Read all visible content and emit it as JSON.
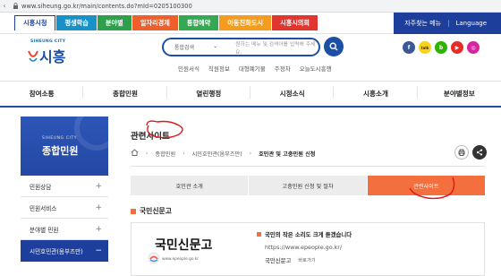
{
  "browser": {
    "url": "www.siheung.go.kr/main/contents.do?mId=0205100300"
  },
  "top_tabs": [
    {
      "label": "시흥시청",
      "color": "#1d3f9b",
      "active": true
    },
    {
      "label": "평생학습",
      "color": "#1891c9",
      "active": false
    },
    {
      "label": "분야별",
      "color": "#2ea04d",
      "active": false
    },
    {
      "label": "일자리경제",
      "color": "#ee5f2b",
      "active": false
    },
    {
      "label": "통합예약",
      "color": "#34a853",
      "active": false
    },
    {
      "label": "아동친화도시",
      "color": "#f39c1d",
      "active": false
    },
    {
      "label": "시흥시의회",
      "color": "#e0362f",
      "active": false
    }
  ],
  "top_links": {
    "freq_menu": "자주찾는 메뉴",
    "language": "Language"
  },
  "header": {
    "logo_small": "SIHEUNG CITY",
    "logo_main": "시흥",
    "search_select": "통합검색",
    "search_placeholder": "원하는 메뉴 및 검색어를 입력해 주세요.",
    "quick_links": [
      "민원서식",
      "직원정보",
      "대형폐기물",
      "주정차",
      "오늘도시흥행"
    ],
    "social": [
      {
        "name": "facebook-icon",
        "color": "#3b5998",
        "glyph": "f"
      },
      {
        "name": "kakao-icon",
        "color": "#f7d417",
        "glyph": "talk"
      },
      {
        "name": "blog-icon",
        "color": "#2db400",
        "glyph": "b"
      },
      {
        "name": "youtube-icon",
        "color": "#e52d27",
        "glyph": "▶"
      },
      {
        "name": "instagram-icon",
        "color": "#d6249f",
        "glyph": "◎"
      }
    ]
  },
  "gnb": [
    "참여소통",
    "종합민원",
    "열린행정",
    "시정소식",
    "시흥소개",
    "분야별정보"
  ],
  "sidebar": {
    "sub": "SIHEUNG CITY",
    "title": "종합민원",
    "items": [
      {
        "label": "민원상담",
        "active": false
      },
      {
        "label": "민원서비스",
        "active": false
      },
      {
        "label": "분야별 민원",
        "active": false
      },
      {
        "label": "시민호민관(옴부즈만)",
        "active": true
      }
    ]
  },
  "content": {
    "page_title": "관련사이트",
    "breadcrumb": [
      "종합민원",
      "시민호민관(옴부즈만)",
      "호민관 및 고충민원 신청"
    ],
    "tabs": [
      {
        "label": "호민관 소개",
        "active": false
      },
      {
        "label": "고충민원 신청 및 절차",
        "active": false
      },
      {
        "label": "관련사이트",
        "active": true
      }
    ],
    "section_title": "국민신문고",
    "card": {
      "logo_text": "국민신문고",
      "logo_url": "www.epeople.go.kr",
      "headline": "국민의 작은 소리도 크게 듣겠습니다",
      "link": "https://www.epeople.go.kr/",
      "link_label": "국민신문고",
      "shortcut": "바로가기"
    }
  },
  "colors": {
    "brand_blue": "#1d3f9b",
    "accent_orange": "#f36f3d",
    "annotation_red": "#e0161d"
  }
}
